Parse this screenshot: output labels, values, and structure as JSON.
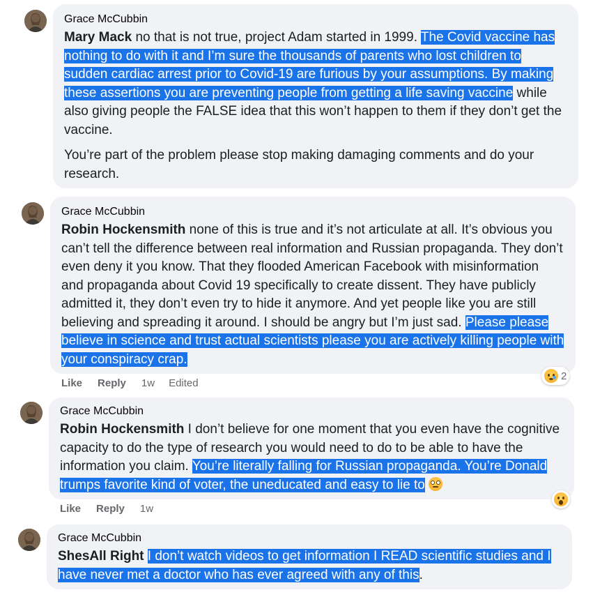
{
  "comments": [
    {
      "author": "Grace McCubbin",
      "mention": "Mary Mack",
      "text_plain": " no that is not true, project Adam started in 1999. ",
      "text_highlight": "The Covid vaccine has nothing to do with it and I’m sure the thousands of parents who lost children to sudden cardiac arrest prior to Covid-19 are furious by your assumptions. By making these assertions you are preventing people from getting a life saving vaccine",
      "text_after": " while also giving people the FALSE idea that this won’t happen to them if they don’t get the vaccine.",
      "para2": "You’re part of the problem please stop making damaging comments and do your research."
    },
    {
      "author": "Grace McCubbin",
      "mention": "Robin Hockensmith",
      "text_plain": " none of this is true and it’s not articulate at all. It’s obvious you can’t tell the difference between real information and Russian propaganda. They don’t even deny it you know. That they flooded American Facebook with misinformation and propaganda about Covid 19 specifically to create dissent. They have publicly admitted it, they don’t even try to hide it anymore. And yet people like you are still believing and spreading it around. I should be angry but I’m just sad. ",
      "text_highlight": "Please please believe in science and trust actual scientists please you are actively killing people with your conspiracy crap.",
      "like": "Like",
      "reply": "Reply",
      "time": "1w",
      "edited": "Edited",
      "reaction_count": "2"
    },
    {
      "author": "Grace McCubbin",
      "mention": "Robin Hockensmith",
      "text_plain": " I don’t believe for one moment that you even have the cognitive capacity to do the type of research you would need to do to be able to have the information you claim. ",
      "text_highlight": "You’re literally falling for Russian propaganda. You’re Donald trumps favorite kind of voter, the uneducated and easy to lie to",
      "like": "Like",
      "reply": "Reply",
      "time": "1w"
    },
    {
      "author": "Grace McCubbin",
      "mention": "ShesAll Right",
      "text_plain": " ",
      "text_highlight": "I don’t watch videos to get information I READ scientific studies and I have never met a doctor who has ever agreed with any of this",
      "text_after": "."
    }
  ],
  "colors": {
    "bubble": "#f0f2f5",
    "highlight": "#1a73e8",
    "meta": "#65676b"
  }
}
